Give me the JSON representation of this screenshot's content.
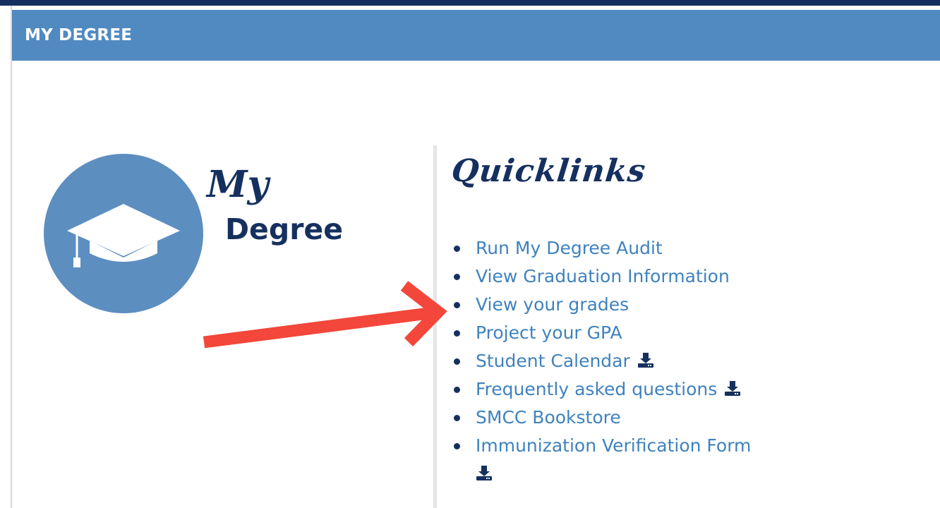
{
  "header": {
    "title": "MY DEGREE"
  },
  "logo": {
    "word_top": "My",
    "word_bottom": "Degree",
    "circle_color": "#5d8ec0",
    "text_color": "#15305f"
  },
  "quicklinks": {
    "title": "Quicklinks",
    "items": [
      {
        "label": "Run My Degree Audit",
        "download": false
      },
      {
        "label": "View Graduation Information",
        "download": false
      },
      {
        "label": "View your grades",
        "download": false
      },
      {
        "label": "Project your GPA",
        "download": false
      },
      {
        "label": "Student Calendar",
        "download": true,
        "icon": "download-icon"
      },
      {
        "label": "Frequently asked questions",
        "download": true,
        "icon": "download-icon"
      },
      {
        "label": "SMCC Bookstore",
        "download": false
      },
      {
        "label": "Immunization Verification Form",
        "download": true,
        "icon": "download-icon"
      }
    ]
  },
  "annotation": {
    "icon": "red-arrow-icon",
    "color": "#f2473a",
    "points_to": "View your grades"
  },
  "colors": {
    "header_bg": "#518ac0",
    "top_line": "#14305e",
    "link": "#3f82bd",
    "bullet": "#15305f"
  }
}
